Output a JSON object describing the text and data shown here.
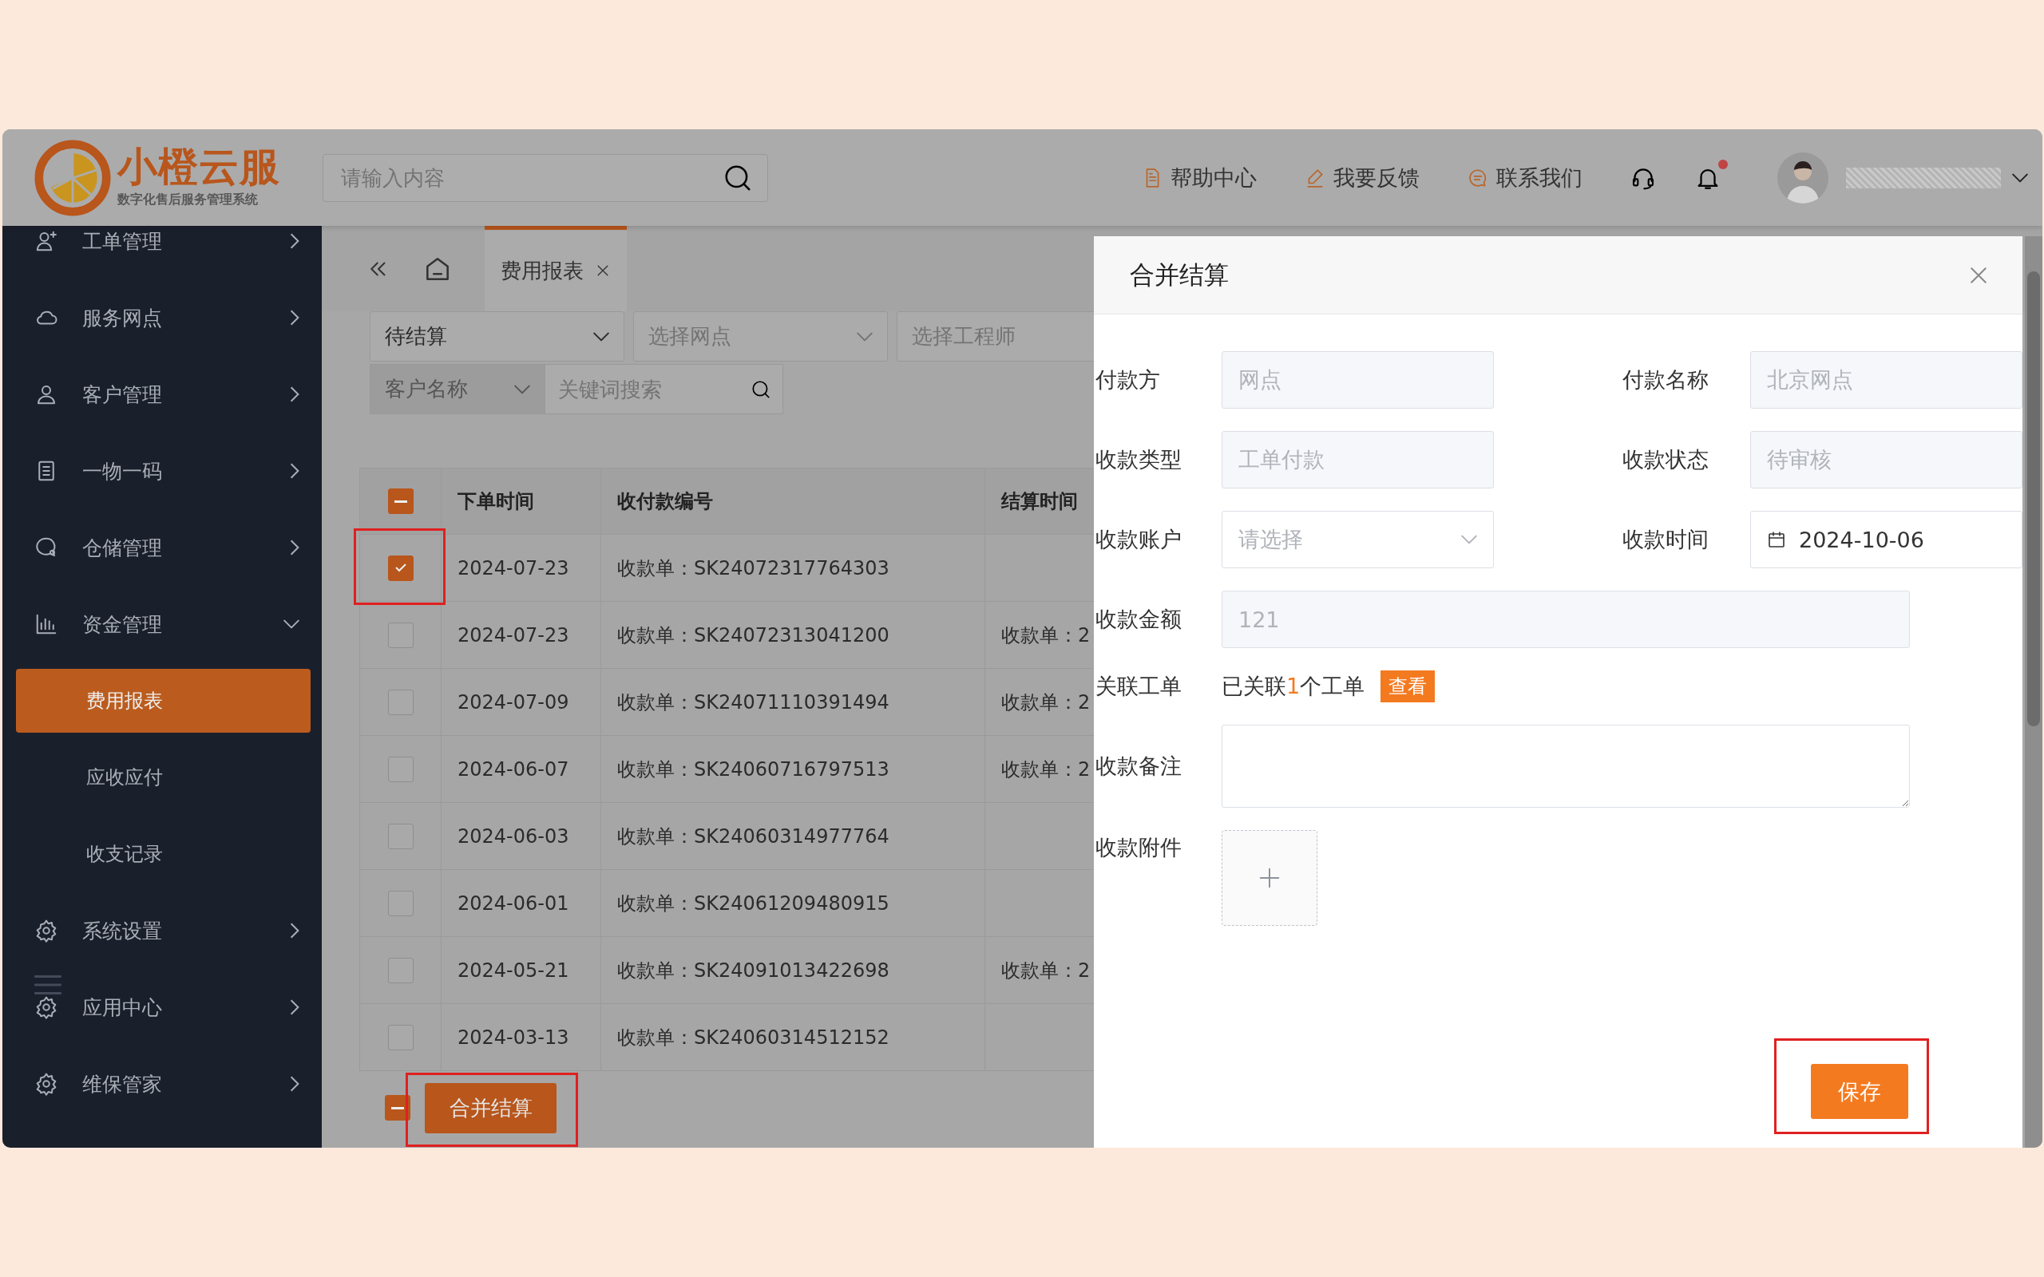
{
  "header": {
    "logo": {
      "title": "小橙云服",
      "subtitle": "数字化售后服务管理系统"
    },
    "search": {
      "placeholder": "请输入内容"
    },
    "links": [
      {
        "kind": "help",
        "label": "帮助中心"
      },
      {
        "kind": "feedback",
        "label": "我要反馈"
      },
      {
        "kind": "contact",
        "label": "联系我们"
      }
    ],
    "notifications": {
      "unread": true
    }
  },
  "sidebar": {
    "items": [
      {
        "label": "工单管理",
        "expanded": false
      },
      {
        "label": "服务网点",
        "expanded": false
      },
      {
        "label": "客户管理",
        "expanded": false
      },
      {
        "label": "一物一码",
        "expanded": false
      },
      {
        "label": "仓储管理",
        "expanded": false
      },
      {
        "label": "资金管理",
        "expanded": true,
        "children": [
          {
            "label": "费用报表",
            "selected": true
          },
          {
            "label": "应收应付",
            "selected": false
          },
          {
            "label": "收支记录",
            "selected": false
          }
        ]
      },
      {
        "label": "系统设置",
        "expanded": false
      },
      {
        "label": "应用中心",
        "expanded": false
      },
      {
        "label": "维保管家",
        "expanded": false
      }
    ]
  },
  "tabs": [
    {
      "label": "费用报表",
      "selected": true
    }
  ],
  "filters": [
    {
      "kind": "select",
      "value": "待结算"
    },
    {
      "kind": "select",
      "placeholder": "选择网点"
    },
    {
      "kind": "select",
      "placeholder": "选择工程师"
    },
    {
      "kind": "prefix",
      "value": "客户名称"
    },
    {
      "kind": "search",
      "placeholder": "关键词搜索"
    }
  ],
  "table": {
    "partially_selected": true,
    "columns": [
      "下单时间",
      "收付款编号",
      "结算时间"
    ],
    "rows": [
      {
        "selected": true,
        "highlighted": true,
        "date": "2024-07-23",
        "number": "收款单：SK24072317764303"
      },
      {
        "selected": false,
        "highlighted": false,
        "date": "2024-07-23",
        "number": "收款单：SK24072313041200",
        "settled": "收款单：2"
      },
      {
        "selected": false,
        "highlighted": false,
        "date": "2024-07-09",
        "number": "收款单：SK24071110391494",
        "settled": "收款单：2"
      },
      {
        "selected": false,
        "highlighted": false,
        "date": "2024-06-07",
        "number": "收款单：SK24060716797513",
        "settled": "收款单：2"
      },
      {
        "selected": false,
        "highlighted": false,
        "date": "2024-06-03",
        "number": "收款单：SK24060314977764"
      },
      {
        "selected": false,
        "highlighted": false,
        "date": "2024-06-01",
        "number": "收款单：SK24061209480915"
      },
      {
        "selected": false,
        "highlighted": false,
        "date": "2024-05-21",
        "number": "收款单：SK24091013422698",
        "settled": "收款单：2"
      },
      {
        "selected": false,
        "highlighted": false,
        "date": "2024-03-13",
        "number": "收款单：SK24060314512152"
      }
    ]
  },
  "footer": {
    "partially_selected": true,
    "button": "合并结算",
    "highlighted": true
  },
  "dialog": {
    "title": "合并结算",
    "fields": [
      {
        "kind": "readonly",
        "label": "付款方",
        "value": "网点"
      },
      {
        "kind": "readonly",
        "label": "付款名称",
        "value": "北京网点"
      },
      {
        "kind": "readonly",
        "label": "收款类型",
        "value": "工单付款"
      },
      {
        "kind": "readonly",
        "label": "收款状态",
        "value": "待审核"
      },
      {
        "kind": "select",
        "label": "收款账户",
        "placeholder": "请选择"
      },
      {
        "kind": "date",
        "label": "收款时间",
        "value": "2024-10-06"
      },
      {
        "kind": "readonly-wide",
        "label": "收款金额",
        "value": "121"
      },
      {
        "kind": "linked",
        "label": "关联工单",
        "text": "已关联",
        "count": "1",
        "suffix": "个工单",
        "action": "查看"
      },
      {
        "kind": "textarea",
        "label": "收款备注"
      },
      {
        "kind": "upload",
        "label": "收款附件"
      }
    ],
    "save": {
      "label": "保存",
      "highlighted": true
    }
  }
}
